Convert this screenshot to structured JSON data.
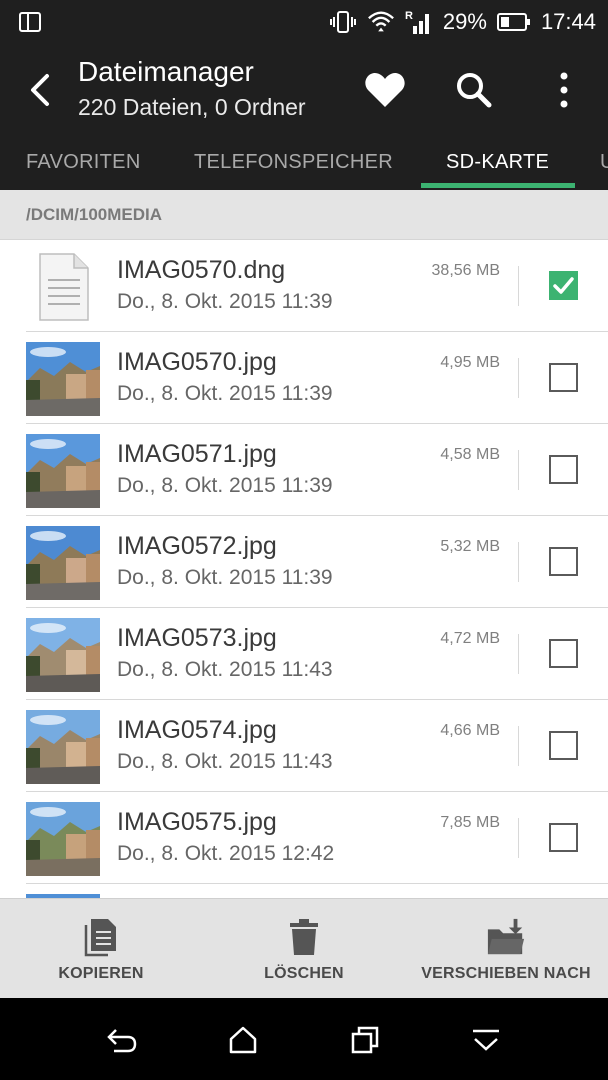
{
  "status_bar": {
    "battery_percent": "29%",
    "time": "17:44",
    "icons": [
      "multi-window-icon",
      "vibrate-icon",
      "wifi-icon",
      "signal-roaming-icon",
      "battery-icon"
    ]
  },
  "app_bar": {
    "title": "Dateimanager",
    "subtitle": "220 Dateien, 0 Ordner",
    "actions": [
      "favorite-icon",
      "search-icon",
      "overflow-menu-icon"
    ]
  },
  "tabs": [
    {
      "label": "FAVORITEN",
      "active": false
    },
    {
      "label": "TELEFONSPEICHER",
      "active": false
    },
    {
      "label": "SD-KARTE",
      "active": true
    },
    {
      "label": "U",
      "active": false
    }
  ],
  "path": "/DCIM/100MEDIA",
  "files": [
    {
      "name": "IMAG0570.dng",
      "date": "Do., 8. Okt. 2015 11:39",
      "size": "38,56 MB",
      "type": "document",
      "checked": true
    },
    {
      "name": "IMAG0570.jpg",
      "date": "Do., 8. Okt. 2015 11:39",
      "size": "4,95 MB",
      "type": "photo",
      "checked": false
    },
    {
      "name": "IMAG0571.jpg",
      "date": "Do., 8. Okt. 2015 11:39",
      "size": "4,58 MB",
      "type": "photo",
      "checked": false
    },
    {
      "name": "IMAG0572.jpg",
      "date": "Do., 8. Okt. 2015 11:39",
      "size": "5,32 MB",
      "type": "photo",
      "checked": false
    },
    {
      "name": "IMAG0573.jpg",
      "date": "Do., 8. Okt. 2015 11:43",
      "size": "4,72 MB",
      "type": "photo",
      "checked": false
    },
    {
      "name": "IMAG0574.jpg",
      "date": "Do., 8. Okt. 2015 11:43",
      "size": "4,66 MB",
      "type": "photo",
      "checked": false
    },
    {
      "name": "IMAG0575.jpg",
      "date": "Do., 8. Okt. 2015 12:42",
      "size": "7,85 MB",
      "type": "photo",
      "checked": false
    }
  ],
  "bottom_actions": [
    {
      "label": "KOPIEREN",
      "icon": "copy-icon"
    },
    {
      "label": "LÖSCHEN",
      "icon": "trash-icon"
    },
    {
      "label": "VERSCHIEBEN NACH",
      "icon": "move-folder-icon"
    }
  ],
  "nav_bar": [
    "back-nav-icon",
    "home-nav-icon",
    "recents-nav-icon",
    "hide-nav-icon"
  ],
  "colors": {
    "bar_background": "#1f1f1f",
    "accent": "#3cb371",
    "action_bar_background": "#e3e3e3"
  }
}
